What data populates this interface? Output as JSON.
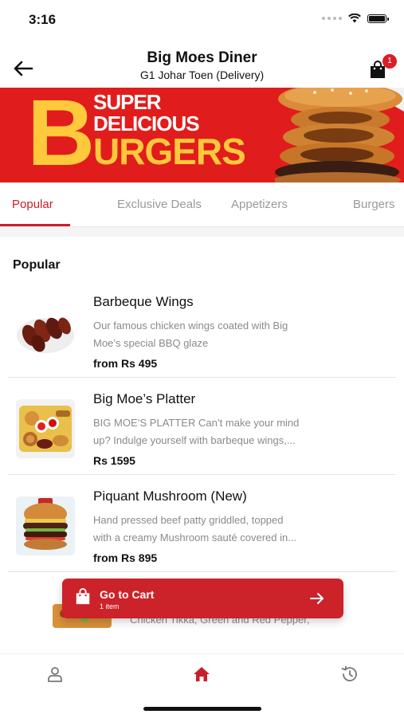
{
  "status_bar": {
    "time": "3:16"
  },
  "header": {
    "title": "Big Moes Diner",
    "subtitle": "G1 Johar Toen  (Delivery)",
    "cart_badge": "1"
  },
  "banner": {
    "letter": "B",
    "line1": "SUPER",
    "line2": "DELICIOUS",
    "line3": "URGERS"
  },
  "tabs": [
    {
      "label": "Popular",
      "active": true
    },
    {
      "label": "Exclusive Deals",
      "active": false
    },
    {
      "label": "Appetizers",
      "active": false
    },
    {
      "label": "Burgers",
      "active": false
    }
  ],
  "section_title": "Popular",
  "items": [
    {
      "name": "Barbeque Wings",
      "desc_line1": "Our famous chicken wings coated with Big",
      "desc_line2": "Moe’s special BBQ glaze",
      "price": "from Rs 495"
    },
    {
      "name": "Big Moe’s Platter",
      "desc_line1": "BIG MOE’S PLATTER Can’t make your mind",
      "desc_line2": "up? Indulge yourself with barbeque wings,...",
      "price": "Rs 1595"
    },
    {
      "name": "Piquant Mushroom (New)",
      "desc_line1": "Hand pressed beef patty griddled, topped",
      "desc_line2": "with a creamy Mushroom sauté covered in...",
      "price": "from Rs 895"
    }
  ],
  "partial_item": {
    "desc": "Chicken Tikka, Green and Red Pepper,"
  },
  "cart_button": {
    "label": "Go to Cart",
    "count": "1 item"
  },
  "bottom_nav": [
    "profile-icon",
    "home-icon",
    "history-icon"
  ],
  "colors": {
    "accent": "#c8202a",
    "banner_red": "#e11c1c",
    "banner_yellow": "#ffc93c"
  }
}
